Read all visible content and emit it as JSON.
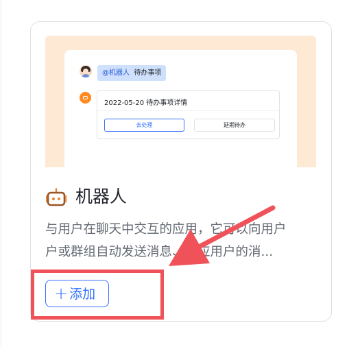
{
  "card": {
    "preview": {
      "mention_prefix": "@机器人",
      "mention_text": "待办事项",
      "message_title": "2022-05-20 待办事项详情",
      "primary_button": "去处理",
      "secondary_button": "延期待办"
    },
    "icon": "robot-icon",
    "title": "机器人",
    "description_line1": "与用户在聊天中交互的应用，它可以向用户",
    "description_line2": "户或群组自动发送消息、响应用户的消...",
    "add_button": {
      "icon": "plus-icon",
      "label": "添加"
    }
  },
  "annotation": {
    "highlight_color": "#f0525a",
    "arrow_color": "#f0525a"
  },
  "colors": {
    "accent": "#3370ff",
    "preview_background": "#fde9d4",
    "bot_orange": "#ff8a1f"
  }
}
